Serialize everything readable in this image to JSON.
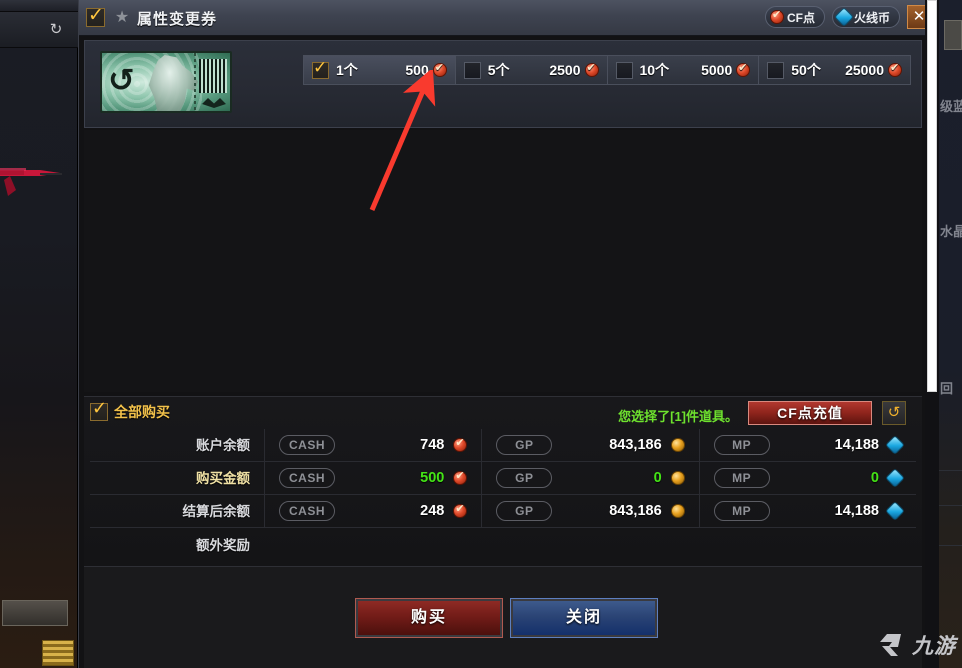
{
  "window": {
    "title": "属性变更券",
    "star_icon": "star-icon",
    "header_checkbox_checked": true,
    "currency_buttons": [
      {
        "label": "CF点",
        "icon": "cf-coin-icon"
      },
      {
        "label": "火线币",
        "icon": "mp-gem-icon"
      }
    ],
    "close_label": "✕"
  },
  "item": {
    "icon_name": "attribute-change-ticket-image",
    "quantity_options": [
      {
        "count_label": "1个",
        "price": "500",
        "currency_icon": "cf-coin-icon",
        "selected": true
      },
      {
        "count_label": "5个",
        "price": "2500",
        "currency_icon": "cf-coin-icon",
        "selected": false
      },
      {
        "count_label": "10个",
        "price": "5000",
        "currency_icon": "cf-coin-icon",
        "selected": false
      },
      {
        "count_label": "50个",
        "price": "25000",
        "currency_icon": "cf-coin-icon",
        "selected": false
      }
    ]
  },
  "summary": {
    "buy_all_label": "全部购买",
    "buy_all_checked": true,
    "selection_note": "您选择了[1]件道具。",
    "recharge_label": "CF点充值",
    "refresh_icon": "refresh-icon",
    "currency_tags": [
      "CASH",
      "GP",
      "MP"
    ],
    "rows": [
      {
        "label": "账户余额",
        "highlight": false,
        "cells": [
          {
            "tag": "CASH",
            "value": "748",
            "icon": "cf-coin-icon",
            "green": false
          },
          {
            "tag": "GP",
            "value": "843,186",
            "icon": "gp-coin-icon",
            "green": false
          },
          {
            "tag": "MP",
            "value": "14,188",
            "icon": "mp-gem-icon",
            "green": false
          }
        ]
      },
      {
        "label": "购买金额",
        "highlight": true,
        "cells": [
          {
            "tag": "CASH",
            "value": "500",
            "icon": "cf-coin-icon",
            "green": true
          },
          {
            "tag": "GP",
            "value": "0",
            "icon": "gp-coin-icon",
            "green": true
          },
          {
            "tag": "MP",
            "value": "0",
            "icon": "mp-gem-icon",
            "green": true
          }
        ]
      },
      {
        "label": "结算后余额",
        "highlight": false,
        "cells": [
          {
            "tag": "CASH",
            "value": "248",
            "icon": "cf-coin-icon",
            "green": false
          },
          {
            "tag": "GP",
            "value": "843,186",
            "icon": "gp-coin-icon",
            "green": false
          },
          {
            "tag": "MP",
            "value": "14,188",
            "icon": "mp-gem-icon",
            "green": false
          }
        ]
      }
    ],
    "bonus_label": "额外奖励"
  },
  "footer": {
    "buy_label": "购买",
    "close_label": "关闭"
  },
  "annotation": {
    "arrow_color": "#f93a2e",
    "points_at": "500"
  },
  "watermark": {
    "text": "九游"
  },
  "background": {
    "refresh_icon": "refresh-icon",
    "right_labels": [
      "级蓝",
      "水晶",
      "回"
    ]
  },
  "colors": {
    "accent_gold": "#ffc63f",
    "green_value": "#44e316",
    "note_green": "#6ee22e",
    "buy_red": "#8e2a24",
    "close_blue": "#2b4475",
    "recharge_red": "#8e241c",
    "title_text": "#f0f2f5"
  }
}
